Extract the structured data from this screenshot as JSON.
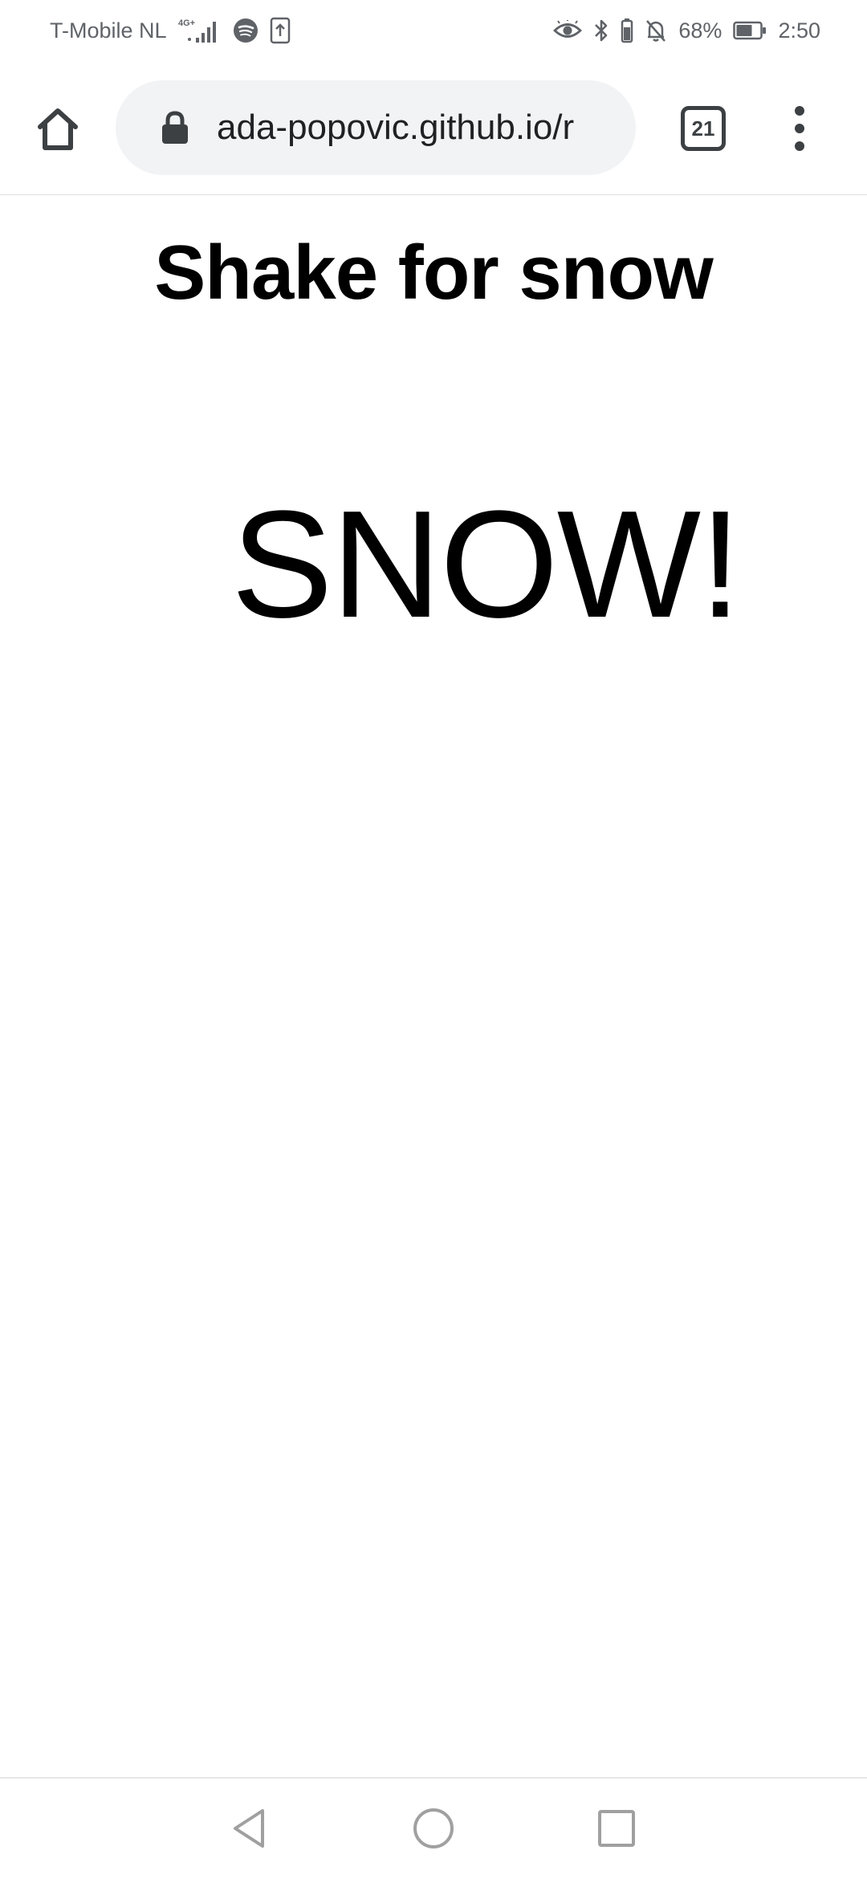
{
  "status_bar": {
    "carrier": "T-Mobile  NL",
    "network_type": "4G+",
    "battery_percent": "68%",
    "time": "2:50",
    "icons_left": [
      "signal-icon",
      "spotify-icon",
      "upload-icon"
    ],
    "icons_right": [
      "eye-comfort-icon",
      "bluetooth-icon",
      "silent-icon",
      "battery-icon"
    ],
    "battery_level": 0.68
  },
  "toolbar": {
    "url": "ada-popovic.github.io/r",
    "tab_count": "21"
  },
  "page": {
    "title": "Shake for snow",
    "snow_text": "SNOW!"
  },
  "colors": {
    "status_text": "#5f6368",
    "omnibox_bg": "#f1f3f4",
    "toolbar_icon": "#3c4043",
    "page_bg": "#ffffff",
    "text": "#000000",
    "nav_icon": "#a0a0a0"
  }
}
